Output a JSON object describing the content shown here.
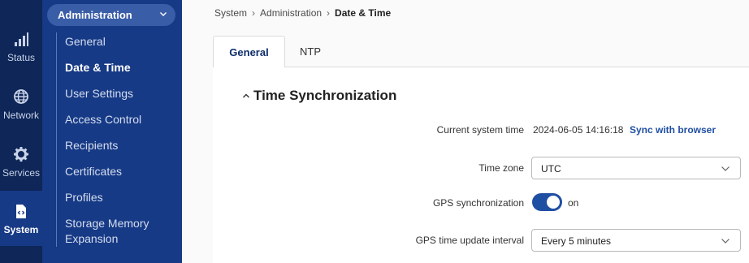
{
  "rail": {
    "items": [
      {
        "label": "Status",
        "icon": "signal-bars-icon"
      },
      {
        "label": "Network",
        "icon": "globe-icon"
      },
      {
        "label": "Services",
        "icon": "gear-icon"
      },
      {
        "label": "System",
        "icon": "system-file-icon"
      }
    ]
  },
  "submenu": {
    "section": "Administration",
    "items": [
      {
        "label": "General"
      },
      {
        "label": "Date & Time"
      },
      {
        "label": "User Settings"
      },
      {
        "label": "Access Control"
      },
      {
        "label": "Recipients"
      },
      {
        "label": "Certificates"
      },
      {
        "label": "Profiles"
      },
      {
        "label": "Storage Memory"
      },
      {
        "label": "Expansion"
      }
    ]
  },
  "breadcrumb": {
    "items": [
      "System",
      "Administration",
      "Date & Time"
    ]
  },
  "tabs": [
    {
      "label": "General"
    },
    {
      "label": "NTP"
    }
  ],
  "section": {
    "title": "Time Synchronization"
  },
  "fields": {
    "current_time": {
      "label": "Current system time",
      "value": "2024-06-05 14:16:18",
      "action": "Sync with browser"
    },
    "time_zone": {
      "label": "Time zone",
      "value": "UTC"
    },
    "gps_sync": {
      "label": "GPS synchronization",
      "state": "on"
    },
    "gps_interval": {
      "label": "GPS time update interval",
      "value": "Every 5 minutes"
    }
  },
  "colors": {
    "rail_bg": "#0e2658",
    "submenu_bg": "#173a86",
    "accent": "#1f4fa3"
  }
}
